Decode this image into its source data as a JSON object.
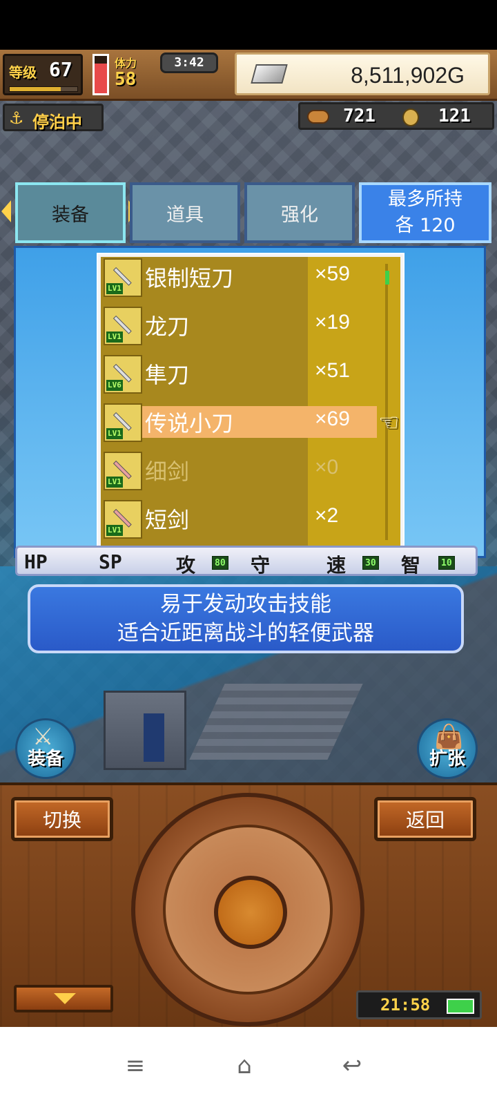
{
  "hud": {
    "level_label": "等级",
    "level_value": "67",
    "level_xp_fraction": 0.75,
    "hp_fraction": 0.8,
    "stamina_label": "体力",
    "stamina_value": "58",
    "clock": "3:42",
    "gold": "8,511,902G",
    "anchor_label": "停泊中",
    "food_count": "721",
    "coin_count": "121"
  },
  "tabs": {
    "equip": "装备",
    "items": "道具",
    "enhance": "强化",
    "max_line1": "最多所持",
    "max_line2": "各 120"
  },
  "items": [
    {
      "name": "银制短刀",
      "qty": "×59",
      "lv": "LV1"
    },
    {
      "name": "龙刀",
      "qty": "×19",
      "lv": "LV1"
    },
    {
      "name": "隼刀",
      "qty": "×51",
      "lv": "LV6"
    },
    {
      "name": "传说小刀",
      "qty": "×69",
      "lv": "LV1"
    },
    {
      "name": "细剑",
      "qty": "×0",
      "lv": "LV1"
    },
    {
      "name": "短剑",
      "qty": "×2",
      "lv": "LV1"
    }
  ],
  "selected_item": "传说小刀",
  "stats": {
    "hp_label": "HP",
    "sp_label": "SP",
    "atk_label": "攻",
    "atk_value": "80",
    "def_label": "守",
    "spd_label": "速",
    "spd_value": "30",
    "int_label": "智",
    "int_value": "10"
  },
  "description": {
    "line1": "易于发动攻击技能",
    "line2": "适合近距离战斗的轻便武器"
  },
  "float_buttons": {
    "equip": "装备",
    "expand": "扩张"
  },
  "controls": {
    "switch": "切换",
    "back": "返回",
    "time": "21:58",
    "battery_fraction": 1.0
  },
  "nav": {
    "menu_icon": "menu-icon",
    "home_icon": "home-icon",
    "back_icon": "back-icon"
  },
  "colors": {
    "panel_blue": "#3fa0e8",
    "list_gold": "#b09020",
    "selected_row": "#f4b46a"
  }
}
